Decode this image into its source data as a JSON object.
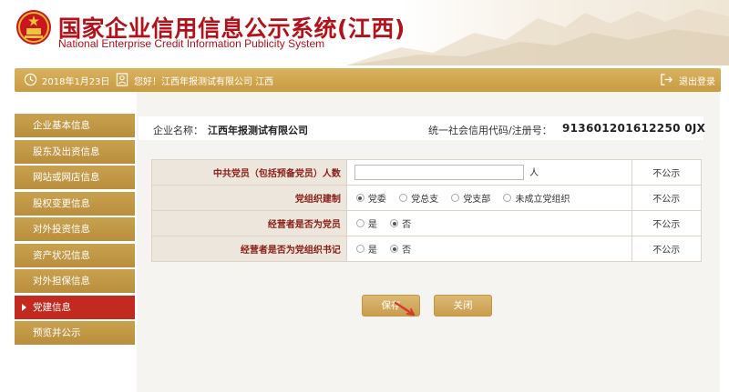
{
  "header": {
    "title": "国家企业信用信息公示系统(江西)",
    "subtitle": "National Enterprise Credit Information Publicity System"
  },
  "topbar": {
    "date": "2018年1月23日",
    "greeting": "您好！江西年报测试有限公司  江西",
    "logout": "退出登录",
    "icons": [
      "clock-icon",
      "user-icon",
      "logout-icon"
    ]
  },
  "sidebar": {
    "items": [
      {
        "label": "企业基本信息",
        "active": false
      },
      {
        "label": "股东及出资信息",
        "active": false
      },
      {
        "label": "网站或网店信息",
        "active": false
      },
      {
        "label": "股权变更信息",
        "active": false
      },
      {
        "label": "对外投资信息",
        "active": false
      },
      {
        "label": "资产状况信息",
        "active": false
      },
      {
        "label": "对外担保信息",
        "active": false
      },
      {
        "label": "党建信息",
        "active": true
      },
      {
        "label": "预览并公示",
        "active": false
      }
    ]
  },
  "company": {
    "name_label": "企业名称：",
    "name_value": "江西年报测试有限公司",
    "code_label": "统一社会信用代码/注册号：",
    "code_value": "913601201612250 0JX"
  },
  "form": {
    "rows": [
      {
        "label": "中共党员（包括预备党员）人数",
        "input_value": "",
        "unit": "人",
        "public": "不公示"
      },
      {
        "label": "党组织建制",
        "options": [
          "党委",
          "党总支",
          "党支部",
          "未成立党组织"
        ],
        "selected": 0,
        "public": "不公示"
      },
      {
        "label": "经营者是否为党员",
        "options": [
          "是",
          "否"
        ],
        "selected": 1,
        "public": "不公示"
      },
      {
        "label": "经营者是否为党组织书记",
        "options": [
          "是",
          "否"
        ],
        "selected": 1,
        "public": "不公示"
      }
    ]
  },
  "buttons": {
    "save": "保存",
    "close": "关闭"
  },
  "colors": {
    "brand_red": "#b3121b",
    "gold": "#c99d4b",
    "active_red": "#c22a1f"
  }
}
